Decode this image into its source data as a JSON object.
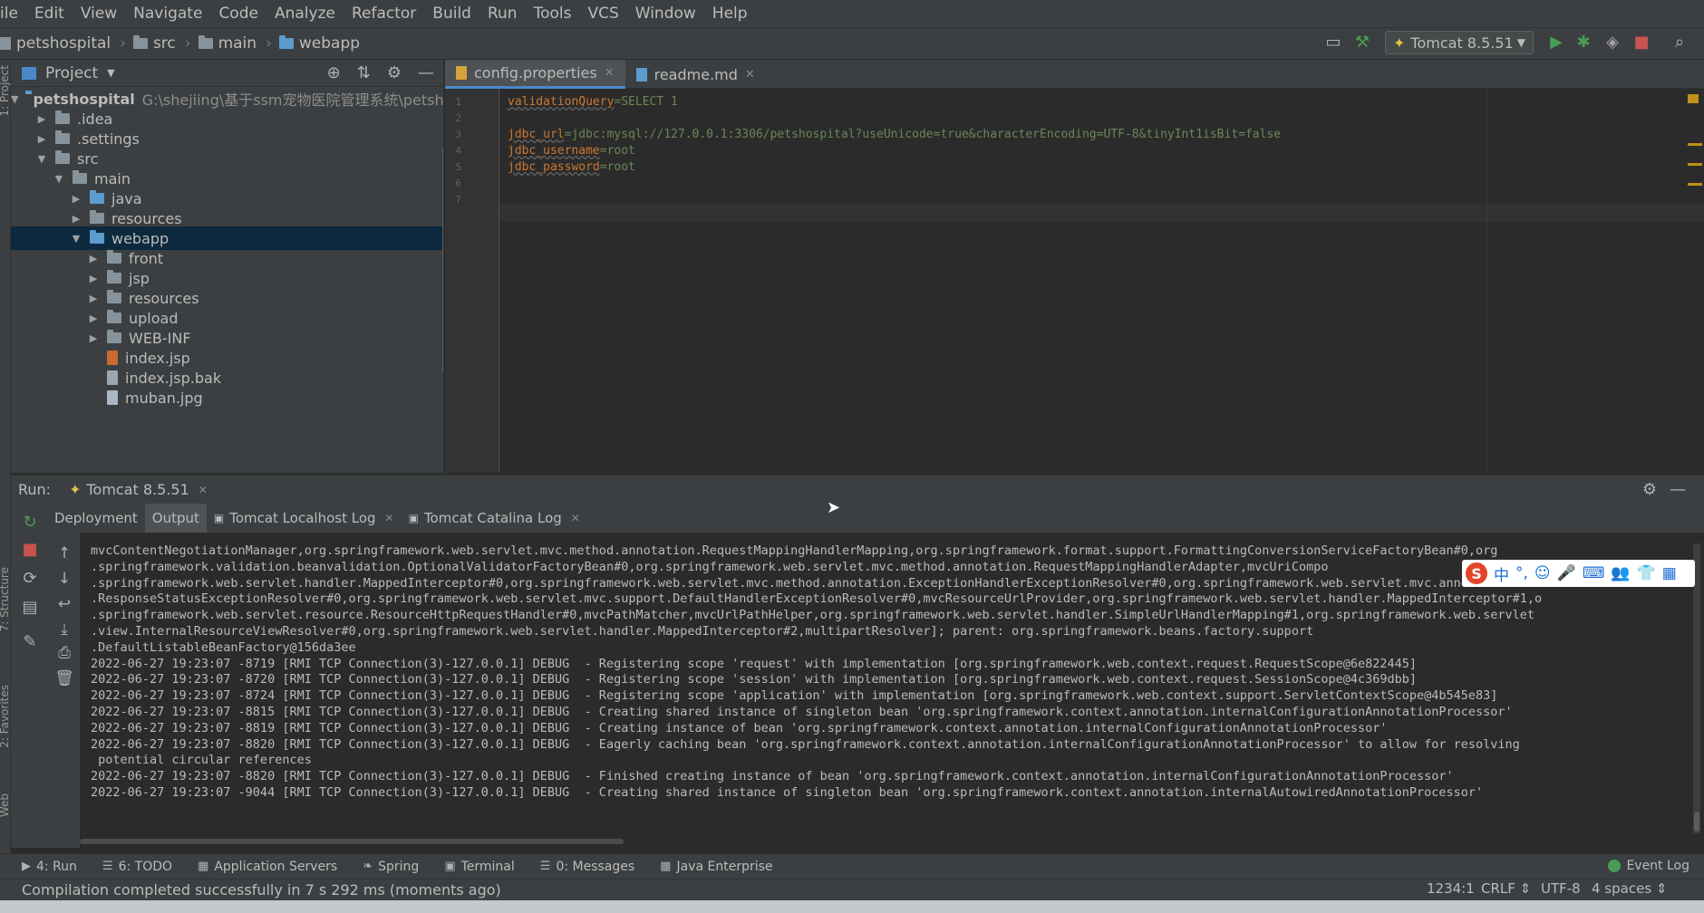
{
  "menu": [
    "ile",
    "Edit",
    "View",
    "Navigate",
    "Code",
    "Analyze",
    "Refactor",
    "Build",
    "Run",
    "Tools",
    "VCS",
    "Window",
    "Help"
  ],
  "breadcrumb": [
    "petshospital",
    "src",
    "main",
    "webapp"
  ],
  "run_config": "Tomcat 8.5.51",
  "project_panel": {
    "title": "Project",
    "tree": [
      {
        "label": "petshospital",
        "path": "G:\\shejiing\\基于ssm宠物医院管理系统\\petshosp",
        "arrow": "▼",
        "indent": 0,
        "icon": "module"
      },
      {
        "label": ".idea",
        "arrow": "▶",
        "indent": 1,
        "icon": "folder"
      },
      {
        "label": ".settings",
        "arrow": "▶",
        "indent": 1,
        "icon": "folder"
      },
      {
        "label": "src",
        "arrow": "▼",
        "indent": 1,
        "icon": "folder"
      },
      {
        "label": "main",
        "arrow": "▼",
        "indent": 2,
        "icon": "folder"
      },
      {
        "label": "java",
        "arrow": "▶",
        "indent": 3,
        "icon": "folder-blue"
      },
      {
        "label": "resources",
        "arrow": "▶",
        "indent": 3,
        "icon": "folder"
      },
      {
        "label": "webapp",
        "arrow": "▼",
        "indent": 3,
        "icon": "folder-blue",
        "selected": true
      },
      {
        "label": "front",
        "arrow": "▶",
        "indent": 4,
        "icon": "folder"
      },
      {
        "label": "jsp",
        "arrow": "▶",
        "indent": 4,
        "icon": "folder"
      },
      {
        "label": "resources",
        "arrow": "▶",
        "indent": 4,
        "icon": "folder"
      },
      {
        "label": "upload",
        "arrow": "▶",
        "indent": 4,
        "icon": "folder"
      },
      {
        "label": "WEB-INF",
        "arrow": "▶",
        "indent": 4,
        "icon": "folder"
      },
      {
        "label": "index.jsp",
        "arrow": "",
        "indent": 4,
        "icon": "jsp-file"
      },
      {
        "label": "index.jsp.bak",
        "arrow": "",
        "indent": 4,
        "icon": "file"
      },
      {
        "label": "muban.jpg",
        "arrow": "",
        "indent": 4,
        "icon": "image-file"
      }
    ]
  },
  "editor": {
    "tabs": [
      {
        "label": "config.properties",
        "active": true
      },
      {
        "label": "readme.md",
        "active": false
      }
    ],
    "lines": [
      {
        "n": "1",
        "key": "validationQuery",
        "val": "=SELECT 1"
      },
      {
        "n": "2",
        "key": "",
        "val": ""
      },
      {
        "n": "3",
        "key": "jdbc_url",
        "val": "=jdbc:mysql://127.0.0.1:3306/petshospital?useUnicode=true&characterEncoding=UTF-8&tinyInt1isBit=false"
      },
      {
        "n": "4",
        "key": "jdbc_username",
        "val": "=root"
      },
      {
        "n": "5",
        "key": "jdbc_password",
        "val": "=root"
      },
      {
        "n": "6",
        "key": "",
        "val": ""
      },
      {
        "n": "7",
        "key": "",
        "val": ""
      }
    ]
  },
  "run_panel": {
    "label": "Run:",
    "config_tab": "Tomcat 8.5.51",
    "tabs": [
      "Deployment",
      "Output",
      "Tomcat Localhost Log",
      "Tomcat Catalina Log"
    ],
    "active_tab": "Output",
    "log_lines": [
      "mvcContentNegotiationManager,org.springframework.web.servlet.mvc.method.annotation.RequestMappingHandlerMapping,org.springframework.format.support.FormattingConversionServiceFactoryBean#0,org",
      ".springframework.validation.beanvalidation.OptionalValidatorFactoryBean#0,org.springframework.web.servlet.mvc.method.annotation.RequestMappingHandlerAdapter,mvcUriCompo",
      ".springframework.web.servlet.handler.MappedInterceptor#0,org.springframework.web.servlet.mvc.method.annotation.ExceptionHandlerExceptionResolver#0,org.springframework.web.servlet.mvc.annotation",
      ".ResponseStatusExceptionResolver#0,org.springframework.web.servlet.mvc.support.DefaultHandlerExceptionResolver#0,mvcResourceUrlProvider,org.springframework.web.servlet.handler.MappedInterceptor#1,o",
      ".springframework.web.servlet.resource.ResourceHttpRequestHandler#0,mvcPathMatcher,mvcUrlPathHelper,org.springframework.web.servlet.handler.SimpleUrlHandlerMapping#1,org.springframework.web.servlet",
      ".view.InternalResourceViewResolver#0,org.springframework.web.servlet.handler.MappedInterceptor#2,multipartResolver]; parent: org.springframework.beans.factory.support",
      ".DefaultListableBeanFactory@156da3ee",
      "2022-06-27 19:23:07 -8719 [RMI TCP Connection(3)-127.0.0.1] DEBUG  - Registering scope 'request' with implementation [org.springframework.web.context.request.RequestScope@6e822445]",
      "2022-06-27 19:23:07 -8720 [RMI TCP Connection(3)-127.0.0.1] DEBUG  - Registering scope 'session' with implementation [org.springframework.web.context.request.SessionScope@4c369dbb]",
      "2022-06-27 19:23:07 -8724 [RMI TCP Connection(3)-127.0.0.1] DEBUG  - Registering scope 'application' with implementation [org.springframework.web.context.support.ServletContextScope@4b545e83]",
      "2022-06-27 19:23:07 -8815 [RMI TCP Connection(3)-127.0.0.1] DEBUG  - Creating shared instance of singleton bean 'org.springframework.context.annotation.internalConfigurationAnnotationProcessor'",
      "2022-06-27 19:23:07 -8819 [RMI TCP Connection(3)-127.0.0.1] DEBUG  - Creating instance of bean 'org.springframework.context.annotation.internalConfigurationAnnotationProcessor'",
      "2022-06-27 19:23:07 -8820 [RMI TCP Connection(3)-127.0.0.1] DEBUG  - Eagerly caching bean 'org.springframework.context.annotation.internalConfigurationAnnotationProcessor' to allow for resolving",
      " potential circular references",
      "2022-06-27 19:23:07 -8820 [RMI TCP Connection(3)-127.0.0.1] DEBUG  - Finished creating instance of bean 'org.springframework.context.annotation.internalConfigurationAnnotationProcessor'",
      "2022-06-27 19:23:07 -9044 [RMI TCP Connection(3)-127.0.0.1] DEBUG  - Creating shared instance of singleton bean 'org.springframework.context.annotation.internalAutowiredAnnotationProcessor'"
    ]
  },
  "ime_bar": [
    "S",
    "中",
    "°,",
    "☺",
    "🎤",
    "⌨",
    "👥",
    "👕",
    "▦"
  ],
  "tool_tabs": [
    {
      "label": "4: Run",
      "icon": "▶"
    },
    {
      "label": "6: TODO",
      "icon": "☰"
    },
    {
      "label": "Application Servers",
      "icon": "▦"
    },
    {
      "label": "Spring",
      "icon": "❧"
    },
    {
      "label": "Terminal",
      "icon": "▣"
    },
    {
      "label": "0: Messages",
      "icon": "☰"
    },
    {
      "label": "Java Enterprise",
      "icon": "▦"
    }
  ],
  "event_log": "Event Log",
  "status": {
    "message": "Compilation completed successfully in 7 s 292 ms (moments ago)",
    "position": "1234:1",
    "line_sep": "CRLF ⇕",
    "encoding": "UTF-8",
    "indent": "4 spaces ⇕"
  },
  "left_strip_tabs": [
    "1: Project",
    "7: Structure",
    "2: Favorites",
    "Web"
  ],
  "colors": {
    "accent": "#4a88c7",
    "selection": "#0d293e",
    "run_green": "#499c54",
    "stop_red": "#c75450"
  }
}
